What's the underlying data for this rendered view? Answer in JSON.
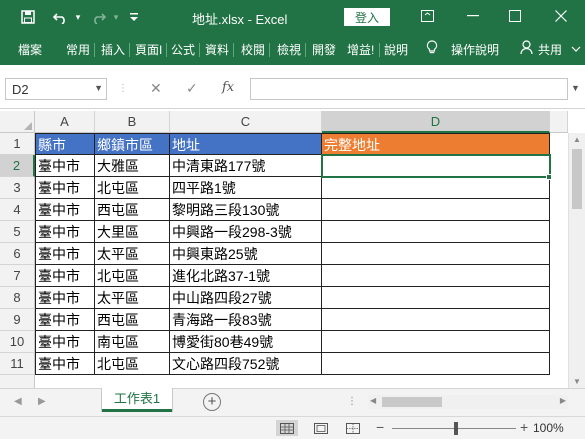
{
  "titlebar": {
    "title": "地址.xlsx  -  Excel",
    "login_label": "登入",
    "bg": "#217346"
  },
  "ribbon": {
    "tabs": [
      "檔案",
      "常用",
      "插入",
      "頁面I",
      "公式",
      "資料",
      "校閱",
      "檢視",
      "開發",
      "增益!",
      "說明"
    ],
    "tell_me": "操作說明",
    "share": "共用"
  },
  "formula_bar": {
    "name_box": "D2",
    "fx": "fx",
    "formula": ""
  },
  "grid": {
    "columns": [
      "A",
      "B",
      "C",
      "D"
    ],
    "selected_column": "D",
    "selected_row": "2",
    "row_numbers": [
      "1",
      "2",
      "3",
      "4",
      "5",
      "6",
      "7",
      "8",
      "9",
      "10",
      "11"
    ],
    "header_row": [
      "縣市",
      "鄉鎮市區",
      "地址",
      "完整地址"
    ],
    "rows": [
      [
        "臺中市",
        "大雅區",
        "中清東路177號",
        ""
      ],
      [
        "臺中市",
        "北屯區",
        "四平路1號",
        ""
      ],
      [
        "臺中市",
        "西屯區",
        "黎明路三段130號",
        ""
      ],
      [
        "臺中市",
        "大里區",
        "中興路一段298-3號",
        ""
      ],
      [
        "臺中市",
        "太平區",
        "中興東路25號",
        ""
      ],
      [
        "臺中市",
        "北屯區",
        "進化北路37-1號",
        ""
      ],
      [
        "臺中市",
        "太平區",
        "中山路四段27號",
        ""
      ],
      [
        "臺中市",
        "西屯區",
        "青海路一段83號",
        ""
      ],
      [
        "臺中市",
        "南屯區",
        "博愛街80巷49號",
        ""
      ],
      [
        "臺中市",
        "北屯區",
        "文心路四段752號",
        ""
      ]
    ],
    "header_blue": "#4472c4",
    "header_orange": "#ed7d31"
  },
  "sheets": {
    "active": "工作表1"
  },
  "statusbar": {
    "zoom": "100%"
  }
}
